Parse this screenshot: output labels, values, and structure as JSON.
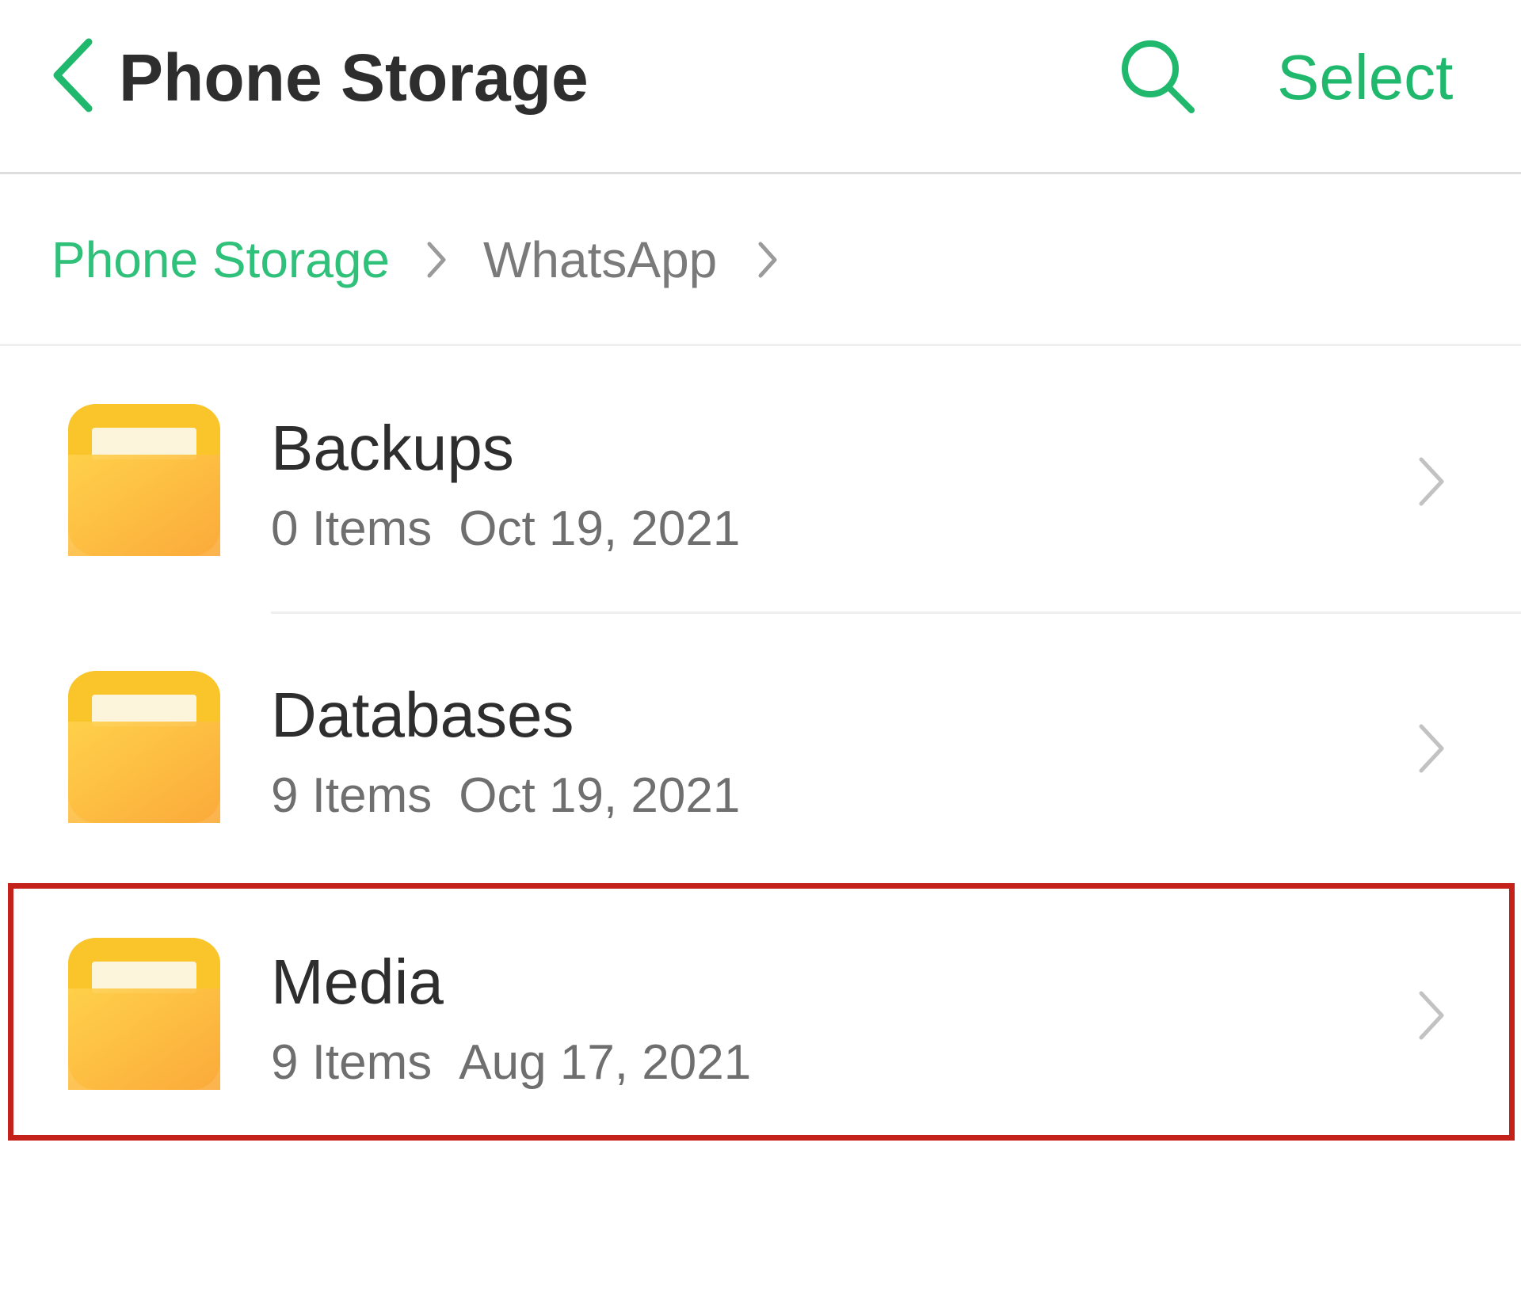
{
  "header": {
    "title": "Phone Storage",
    "back_icon": "chevron-left-icon",
    "search_icon": "search-icon",
    "select_label": "Select",
    "accent_color": "#1fb86c"
  },
  "breadcrumb": {
    "items": [
      {
        "label": "Phone Storage",
        "active": true
      },
      {
        "label": "WhatsApp",
        "active": false
      }
    ],
    "separator_icon": "chevron-right-icon"
  },
  "folders": [
    {
      "name": "Backups",
      "items": "0 Items",
      "date": "Oct 19, 2021",
      "icon": "folder-icon"
    },
    {
      "name": "Databases",
      "items": "9 Items",
      "date": "Oct 19, 2021",
      "icon": "folder-icon"
    },
    {
      "name": "Media",
      "items": "9 Items",
      "date": "Aug 17, 2021",
      "icon": "folder-icon",
      "highlighted": true
    }
  ],
  "highlight_color": "#c4211a",
  "folder_color": "#fbbf3c"
}
